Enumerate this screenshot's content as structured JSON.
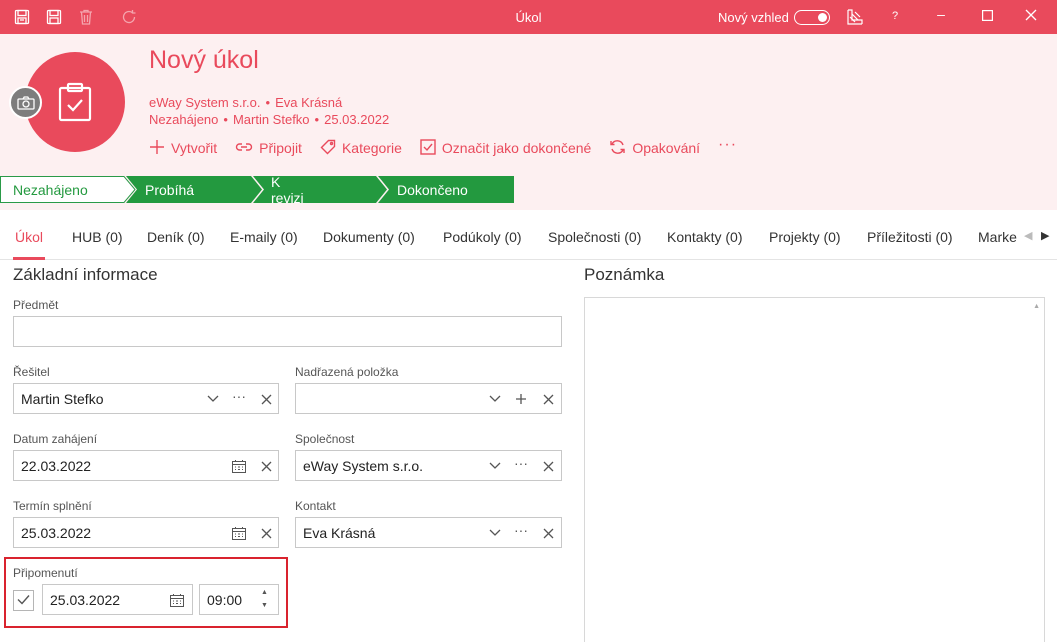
{
  "window": {
    "title": "Úkol",
    "new_look_label": "Nový vzhled",
    "help_label": "?"
  },
  "header": {
    "title": "Nový úkol",
    "company": "eWay System s.r.o.",
    "contact": "Eva Krásná",
    "date": "25.03.2022",
    "status": "Nezahájeno",
    "owner": "Martin Stefko",
    "accent_color": "#e94a5c"
  },
  "actions": [
    {
      "label": "Vytvořit",
      "icon": "plus-icon"
    },
    {
      "label": "Připojit",
      "icon": "link-icon"
    },
    {
      "label": "Kategorie",
      "icon": "tag-icon"
    },
    {
      "label": "Označit jako dokončené",
      "icon": "checkbox-icon"
    },
    {
      "label": "Opakování",
      "icon": "repeat-icon"
    }
  ],
  "steps": [
    {
      "label": "Nezahájeno",
      "active": true
    },
    {
      "label": "Probíhá",
      "active": false
    },
    {
      "label": "K revizi",
      "active": false
    },
    {
      "label": "Dokončeno",
      "active": false
    }
  ],
  "tabs": [
    "Úkol",
    "HUB (0)",
    "Deník (0)",
    "E-maily (0)",
    "Dokumenty (0)",
    "Podúkoly (0)",
    "Společnosti (0)",
    "Kontakty (0)",
    "Projekty (0)",
    "Příležitosti (0)",
    "Marke"
  ],
  "form": {
    "section_title": "Základní informace",
    "note_title": "Poznámka",
    "subject_label": "Předmět",
    "subject_value": "",
    "solver_label": "Řešitel",
    "solver_value": "Martin Stefko",
    "parent_label": "Nadřazená položka",
    "parent_value": "",
    "start_label": "Datum zahájení",
    "start_value": "22.03.2022",
    "company_label": "Společnost",
    "company_value": "eWay System s.r.o.",
    "due_label": "Termín splnění",
    "due_value": "25.03.2022",
    "contact_label": "Kontakt",
    "contact_value": "Eva Krásná",
    "reminder_label": "Připomenutí",
    "reminder_checked": true,
    "reminder_date": "25.03.2022",
    "reminder_time": "09:00"
  }
}
